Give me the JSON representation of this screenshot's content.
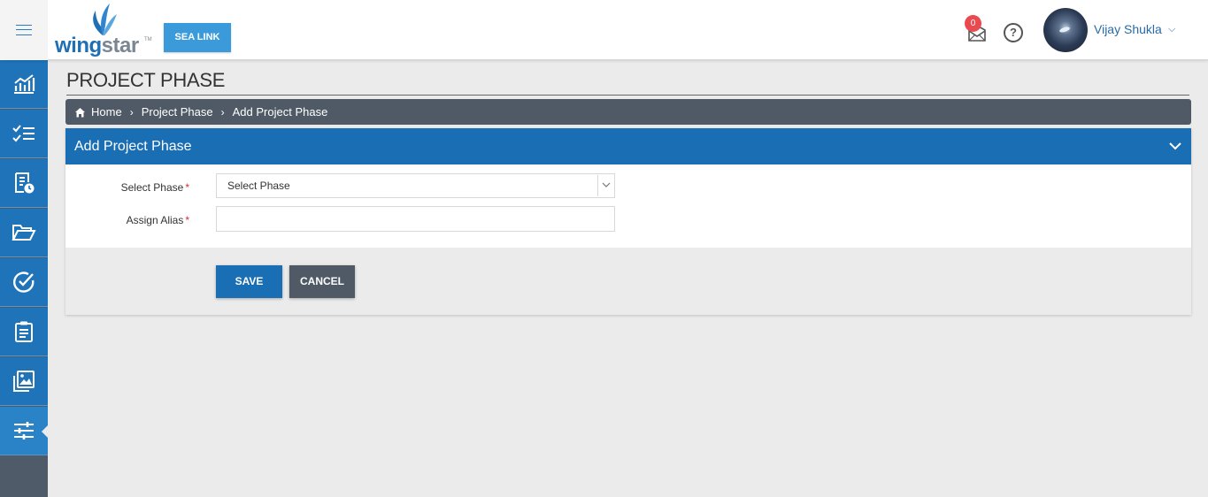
{
  "header": {
    "logo_text_main": "wing",
    "logo_text_accent": "star",
    "logo_tm": "TM",
    "project_button": "SEA LINK",
    "mail_count": "0",
    "help_symbol": "?",
    "user_name": "Vijay Shukla",
    "user_caret": "⌵"
  },
  "sidebar": {
    "items": [
      {
        "icon": "analytics-icon"
      },
      {
        "icon": "task-list-icon"
      },
      {
        "icon": "report-clock-icon"
      },
      {
        "icon": "folder-open-icon"
      },
      {
        "icon": "check-circle-icon"
      },
      {
        "icon": "clipboard-icon"
      },
      {
        "icon": "gallery-icon"
      },
      {
        "icon": "settings-sliders-icon",
        "active": true
      }
    ]
  },
  "page": {
    "title": "PROJECT PHASE"
  },
  "breadcrumb": {
    "home": "Home",
    "sep": "›",
    "level1": "Project Phase",
    "level2": "Add Project Phase"
  },
  "form": {
    "panel_title": "Add Project Phase",
    "select_phase_label": "Select Phase",
    "select_phase_value": "Select Phase",
    "assign_alias_label": "Assign Alias",
    "assign_alias_value": "",
    "required_mark": "*",
    "save_label": "SAVE",
    "cancel_label": "CANCEL"
  },
  "colors": {
    "primary": "#1a6eb4",
    "sidebar_item": "#1f73b9",
    "sidebar_bg": "#4f5b68",
    "breadcrumb_bg": "#4f5a66",
    "badge": "#e84a4f",
    "accent_button": "#3b9ad9"
  }
}
